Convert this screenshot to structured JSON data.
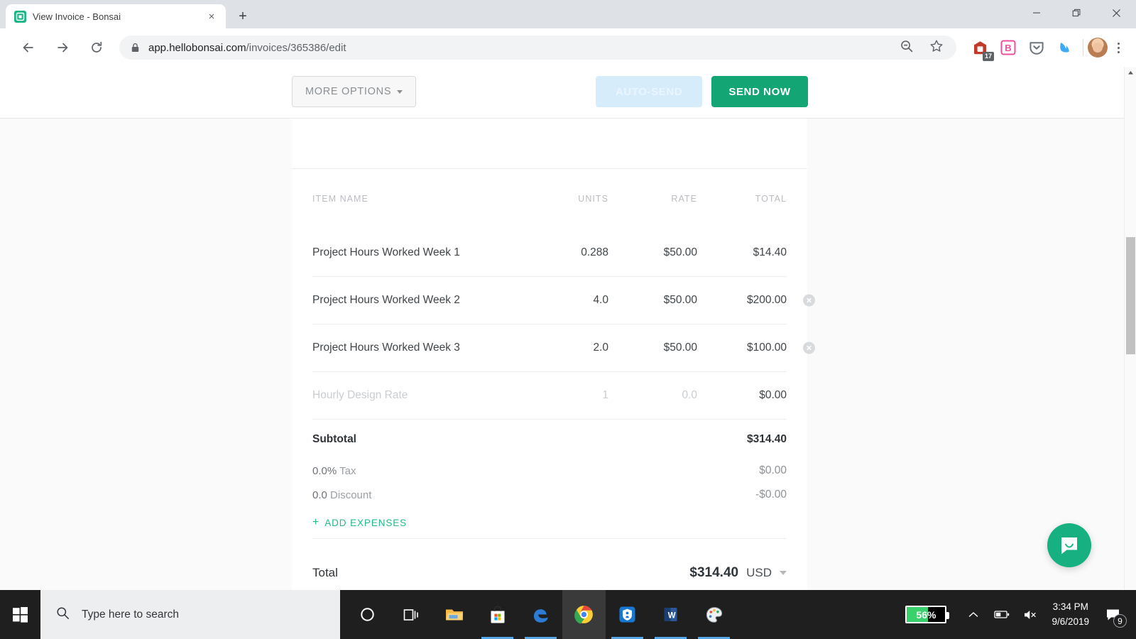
{
  "browser": {
    "tab": {
      "title": "View Invoice - Bonsai",
      "favicon": "bonsai-logo-icon",
      "close": "×"
    },
    "new_tab_label": "+",
    "window_controls": {
      "minimize": "minimize-icon",
      "restore": "restore-icon",
      "close": "close-icon"
    },
    "nav": {
      "back": "back-arrow-icon",
      "forward": "forward-arrow-icon",
      "reload": "reload-icon"
    },
    "omnibox": {
      "lock": "lock-icon",
      "url_host": "app.hellobonsai.com",
      "url_path": "/invoices/365386/edit",
      "zoom_out_icon": "zoom-out-icon",
      "bookmark_icon": "star-icon"
    },
    "extensions": [
      {
        "name": "calendar-extension-icon",
        "badge": "17"
      },
      {
        "name": "b-extension-icon",
        "label": "B"
      },
      {
        "name": "pocket-extension-icon"
      },
      {
        "name": "flame-extension-icon"
      }
    ],
    "profile": "user-avatar",
    "menu": "chrome-menu-icon"
  },
  "actionbar": {
    "more_options": "MORE OPTIONS",
    "auto_send": "AUTO-SEND",
    "send_now": "SEND NOW"
  },
  "invoice": {
    "columns": {
      "name": "ITEM NAME",
      "units": "UNITS",
      "rate": "RATE",
      "total": "TOTAL"
    },
    "rows": [
      {
        "name": "Project Hours Worked Week 1",
        "units": "0.288",
        "rate": "$50.00",
        "total": "$14.40",
        "deletable": false,
        "placeholder": false
      },
      {
        "name": "Project Hours Worked Week 2",
        "units": "4.0",
        "rate": "$50.00",
        "total": "$200.00",
        "deletable": true,
        "placeholder": false
      },
      {
        "name": "Project Hours Worked Week 3",
        "units": "2.0",
        "rate": "$50.00",
        "total": "$100.00",
        "deletable": true,
        "placeholder": false
      },
      {
        "name": "Hourly Design Rate",
        "units": "1",
        "rate": "0.0",
        "total": "$0.00",
        "deletable": false,
        "placeholder": true
      }
    ],
    "subtotal_label": "Subtotal",
    "subtotal_value": "$314.40",
    "tax_rate": "0.0%",
    "tax_label": "Tax",
    "tax_value": "$0.00",
    "discount_rate": "0.0",
    "discount_label": "Discount",
    "discount_value": "-$0.00",
    "add_expenses": "ADD EXPENSES",
    "add_expenses_plus": "+",
    "total_label": "Total",
    "total_value": "$314.40",
    "currency": "USD"
  },
  "support": {
    "intercom": "intercom-chat-icon"
  },
  "taskbar": {
    "start": "windows-start-icon",
    "search_placeholder": "Type here to search",
    "search_icon": "search-icon",
    "apps": [
      {
        "name": "cortana-icon",
        "active": false,
        "running": false
      },
      {
        "name": "task-view-icon",
        "active": false,
        "running": false
      },
      {
        "name": "file-explorer-icon",
        "active": false,
        "running": false
      },
      {
        "name": "microsoft-store-icon",
        "active": false,
        "running": true
      },
      {
        "name": "edge-icon",
        "active": false,
        "running": true
      },
      {
        "name": "chrome-icon",
        "active": true,
        "running": true
      },
      {
        "name": "norton-icon",
        "active": false,
        "running": true
      },
      {
        "name": "word-icon",
        "active": false,
        "running": true
      },
      {
        "name": "paint-icon",
        "active": false,
        "running": true
      }
    ],
    "battery_percent": "56%",
    "tray": {
      "chevron": "show-hidden-icons",
      "battery": "battery-icon",
      "volume": "volume-muted-icon"
    },
    "time": "3:34 PM",
    "date": "9/6/2019",
    "notifications_count": "9"
  },
  "colors": {
    "brand_green": "#13a574",
    "accent_link": "#23b98a",
    "auto_send_bg": "#d6ecfb",
    "battery_green": "#3ad06b"
  }
}
